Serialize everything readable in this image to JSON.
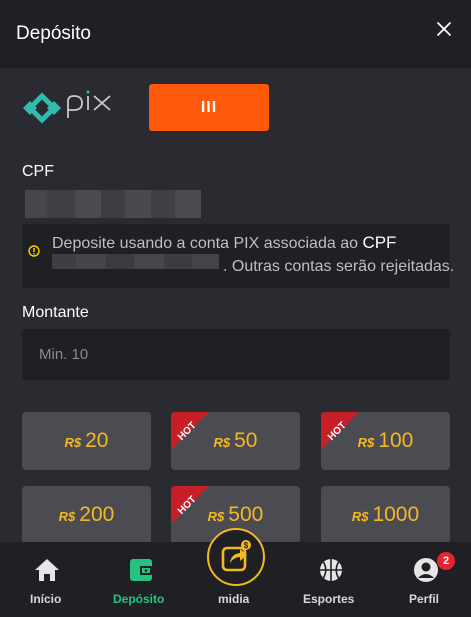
{
  "header": {
    "title": "Depósito"
  },
  "payment": {
    "method_button": "III",
    "brand_colors": {
      "pix_teal": "#32bcad",
      "accent_orange": "#ff5a0a"
    }
  },
  "form": {
    "cpf_label": "CPF",
    "notice_text": "Deposite usando a conta PIX associada ao",
    "notice_emph": "CPF",
    "notice_text2": ". Outras contas serão rejeitadas.",
    "amount_label": "Montante",
    "amount_placeholder": "Min. 10"
  },
  "amounts": [
    {
      "currency": "R$",
      "value": "20",
      "hot": false
    },
    {
      "currency": "R$",
      "value": "50",
      "hot": true
    },
    {
      "currency": "R$",
      "value": "100",
      "hot": true
    },
    {
      "currency": "R$",
      "value": "200",
      "hot": false
    },
    {
      "currency": "R$",
      "value": "500",
      "hot": true
    },
    {
      "currency": "R$",
      "value": "1000",
      "hot": false
    }
  ],
  "hot_label": "HOT",
  "nav": {
    "inicio": "Início",
    "deposito": "Depósito",
    "midia": "midia",
    "esportes": "Esportes",
    "perfil": "Perfil",
    "perfil_badge": "2",
    "active": "deposito"
  },
  "colors": {
    "active_green": "#27c281",
    "gold": "#f5b820",
    "badge_red": "#e8222e"
  }
}
